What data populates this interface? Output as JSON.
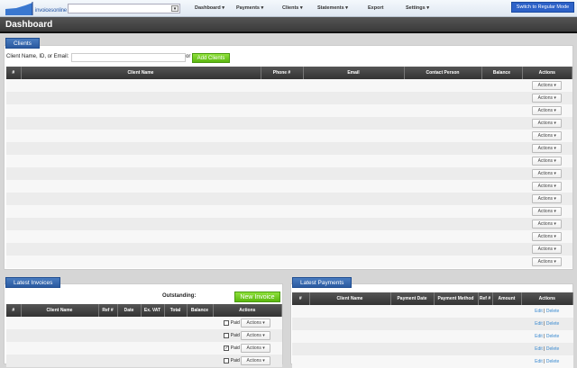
{
  "header": {
    "logo_text": "invoicesonline",
    "nav": [
      "Dashboard",
      "Payments",
      "Clients",
      "Statements",
      "Export",
      "Settings"
    ],
    "switch_label": "Switch to Regular Mode",
    "client_select": ""
  },
  "page": {
    "title": "Dashboard"
  },
  "clients": {
    "tab": "Clients",
    "search_label": "Client Name, ID, or Email:",
    "search_value": "",
    "or": "or",
    "add_label": "Add Clients",
    "columns": [
      "#",
      "Client Name",
      "Phone #",
      "Email",
      "Contact Person",
      "Balance",
      "Actions"
    ],
    "row_count": 15,
    "action_label": "Actions"
  },
  "invoices": {
    "tab": "Latest Invoices",
    "outstanding_label": "Outstanding:",
    "new_label": "New Invoice",
    "columns": [
      "#",
      "Client Name",
      "Ref #",
      "Date",
      "Ex. VAT",
      "Total",
      "Balance",
      "Actions"
    ],
    "paid_label": "Paid",
    "action_label": "Actions",
    "rows": [
      {
        "paid": false
      },
      {
        "paid": false
      },
      {
        "paid": true
      },
      {
        "paid": false
      }
    ]
  },
  "payments": {
    "tab": "Latest Payments",
    "columns": [
      "#",
      "Client Name",
      "Payment Date",
      "Payment Method",
      "Ref #",
      "Amount",
      "Actions"
    ],
    "edit_label": "Edit",
    "sep": "|",
    "delete_label": "Delete",
    "row_count": 5
  }
}
